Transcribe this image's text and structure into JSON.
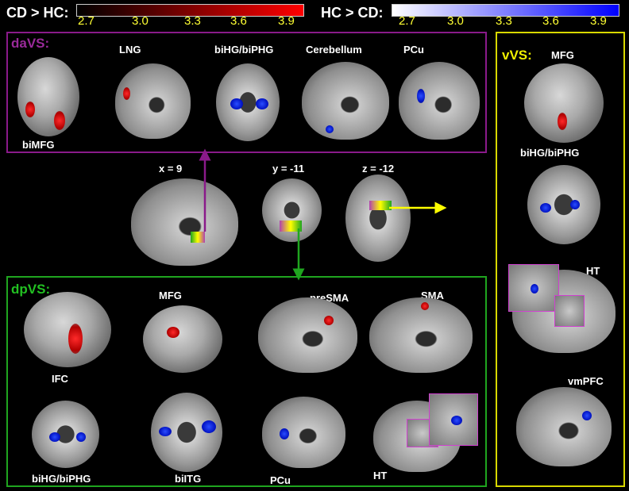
{
  "colorbars": {
    "cd_hc": {
      "label": "CD > HC:",
      "ticks": [
        "2.7",
        "3.0",
        "3.3",
        "3.6",
        "3.9"
      ],
      "color_low": "#000000",
      "color_high": "#ff0000"
    },
    "hc_cd": {
      "label": "HC > CD:",
      "ticks": [
        "2.7",
        "3.0",
        "3.3",
        "3.6",
        "3.9"
      ],
      "color_low": "#ffffff",
      "color_high": "#0000ff"
    }
  },
  "panels": {
    "davs": {
      "title": "daVS:",
      "border_color": "#8a1a8a",
      "labels": [
        "LNG",
        "biHG/biPHG",
        "Cerebellum",
        "PCu",
        "biMFG"
      ]
    },
    "center": {
      "coords": [
        "x = 9",
        "y = -11",
        "z = -12"
      ]
    },
    "dpvs": {
      "title": "dpVS:",
      "border_color": "#1fa51f",
      "labels": [
        "MFG",
        "preSMA",
        "SMA",
        "IFC",
        "biHG/biPHG",
        "biITG",
        "PCu",
        "HT"
      ]
    },
    "vvs": {
      "title": "vVS:",
      "border_color": "#d8d800",
      "labels": [
        "MFG",
        "biHG/biPHG",
        "HT",
        "vmPFC"
      ]
    }
  },
  "colors": {
    "tick_text": "#ffff33",
    "arrow_purple": "#8a1a8a",
    "arrow_green": "#1fa51f",
    "arrow_yellow": "#ffff00"
  }
}
